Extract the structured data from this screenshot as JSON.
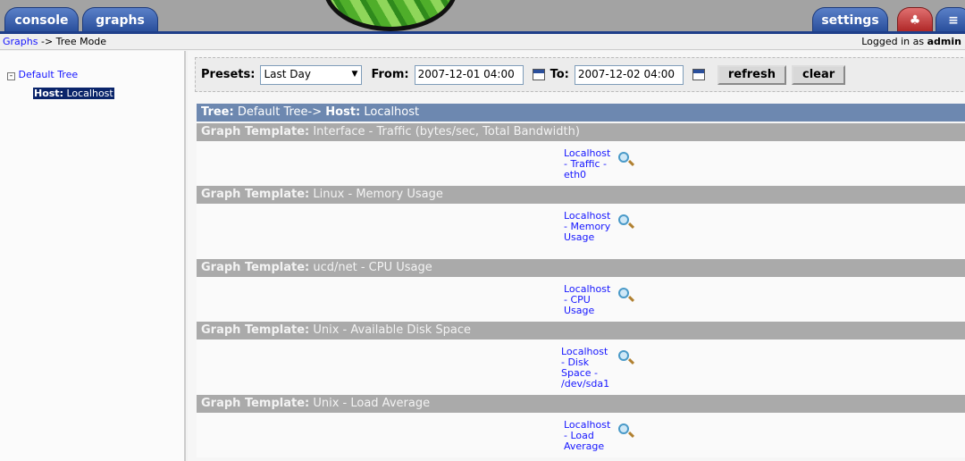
{
  "tabs": {
    "console": "console",
    "graphs": "graphs",
    "settings": "settings",
    "tree_icon": "tree-icon",
    "list_icon": "list-icon"
  },
  "breadcrumb": {
    "link": "Graphs",
    "rest": " -> Tree Mode",
    "login_prefix": "Logged in as ",
    "user": "admin"
  },
  "sidebar": {
    "tree": "Default Tree",
    "host_label": "Host:",
    "host": " Localhost"
  },
  "filter": {
    "presets_label": "Presets:",
    "preset": "Last Day",
    "from_label": "From:",
    "from": "2007-12-01 04:00",
    "to_label": "To:",
    "to": "2007-12-02 04:00",
    "refresh": "refresh",
    "clear": "clear"
  },
  "tree_header": {
    "tree_label": "Tree:",
    "tree": " Default Tree-> ",
    "host_label": "Host:",
    "host": " Localhost"
  },
  "template_label": "Graph Template:",
  "templates": [
    {
      "name": " Interface - Traffic (bytes/sec, Total Bandwidth)",
      "graph": "Localhost - Traffic - eth0"
    },
    {
      "name": " Linux - Memory Usage",
      "graph": "Localhost - Memory Usage"
    },
    {
      "name": " ucd/net - CPU Usage",
      "graph": "Localhost - CPU Usage"
    },
    {
      "name": " Unix - Available Disk Space",
      "graph": "Localhost - Disk Space - /dev/sda1"
    },
    {
      "name": " Unix - Load Average",
      "graph": "Localhost - Load Average"
    }
  ]
}
